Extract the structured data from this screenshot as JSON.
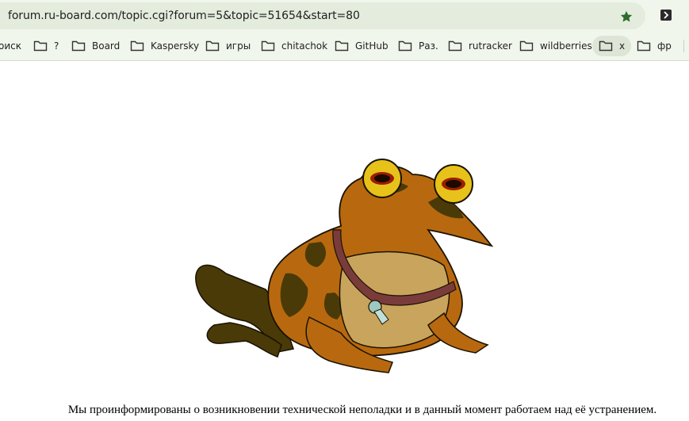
{
  "address_bar": {
    "url": "forum.ru-board.com/topic.cgi?forum=5&topic=51654&start=80",
    "bookmark_icon": "star-icon",
    "extension_icon": "extension-icon"
  },
  "bookmarks": [
    {
      "label": "оиск"
    },
    {
      "label": "?"
    },
    {
      "label": "Board"
    },
    {
      "label": "Kaspersky"
    },
    {
      "label": "игры"
    },
    {
      "label": "chitachok"
    },
    {
      "label": "GitHub"
    },
    {
      "label": "Раз."
    },
    {
      "label": "rutracker"
    },
    {
      "label": "wildberries"
    },
    {
      "label": "x"
    },
    {
      "label": "фр"
    }
  ],
  "colors": {
    "star": "#2e6b2e",
    "toad_body": "#b8690f",
    "toad_spots": "#4a3a08",
    "toad_belly": "#c9a45c",
    "collar": "#7a3b3b"
  },
  "content": {
    "image": "hypnotoad",
    "message": "Мы проинформированы о возникновении технической неполадки и в данный момент работаем над её устранением."
  }
}
